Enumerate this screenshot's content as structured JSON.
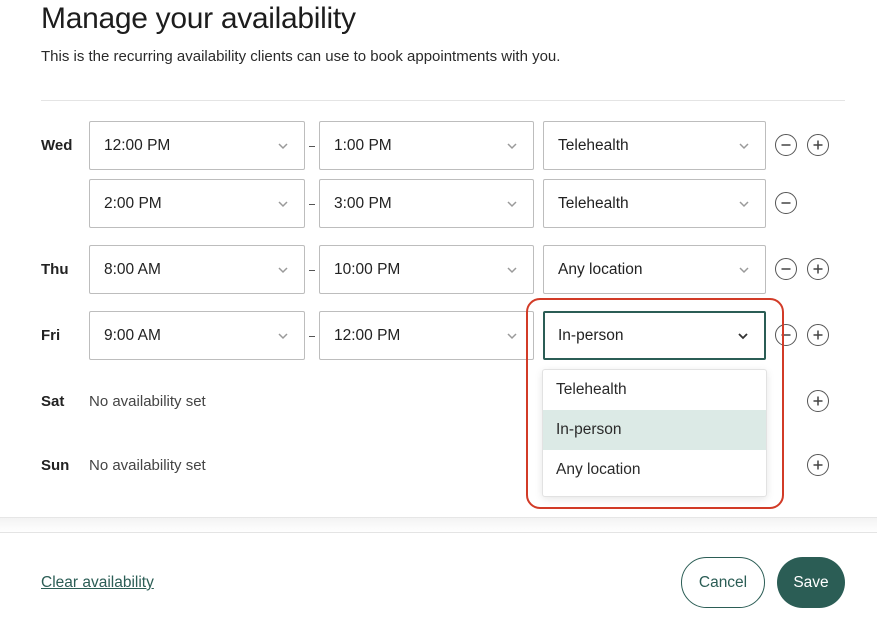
{
  "header": {
    "title": "Manage your availability",
    "subtitle": "This is the recurring availability clients can use to book appointments with you."
  },
  "days": {
    "wed": {
      "label": "Wed",
      "slots": [
        {
          "start": "12:00 PM",
          "end": "1:00 PM",
          "location": "Telehealth"
        },
        {
          "start": "2:00 PM",
          "end": "3:00 PM",
          "location": "Telehealth"
        }
      ]
    },
    "thu": {
      "label": "Thu",
      "slots": [
        {
          "start": "8:00 AM",
          "end": "10:00 PM",
          "location": "Any location"
        }
      ]
    },
    "fri": {
      "label": "Fri",
      "slots": [
        {
          "start": "9:00 AM",
          "end": "12:00 PM",
          "location": "In-person"
        }
      ]
    },
    "sat": {
      "label": "Sat",
      "empty_text": "No availability set"
    },
    "sun": {
      "label": "Sun",
      "empty_text": "No availability set"
    }
  },
  "location_menu": {
    "options": [
      "Telehealth",
      "In-person",
      "Any location"
    ],
    "selected": "In-person"
  },
  "footer": {
    "clear_label": "Clear availability",
    "cancel_label": "Cancel",
    "save_label": "Save"
  },
  "colors": {
    "accent": "#2b5d55",
    "menu_highlight": "#dceae6",
    "annotation_border": "#d23b27"
  },
  "icons": {
    "select_arrow": "chevron-down-icon",
    "remove": "minus-circle-icon",
    "add": "plus-circle-icon"
  }
}
